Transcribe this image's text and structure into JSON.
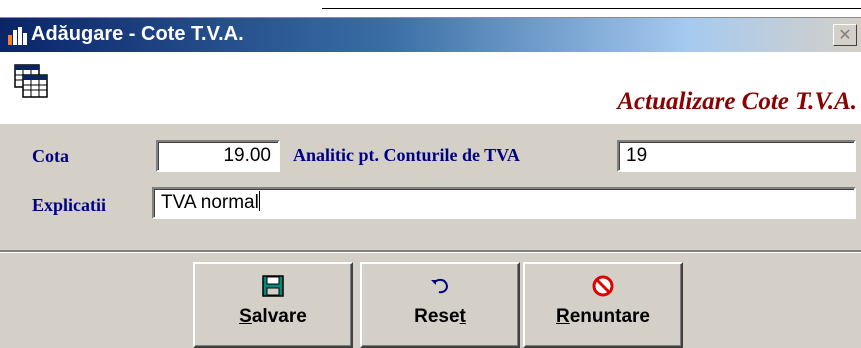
{
  "window": {
    "title": "Adăugare - Cote T.V.A.",
    "close_symbol": "✕"
  },
  "banner": {
    "title": "Actualizare Cote T.V.A."
  },
  "form": {
    "cota_label": "Cota",
    "cota_value": "19.00",
    "analitic_label": "Analitic pt. Conturile de TVA",
    "analitic_value": "19",
    "explicatii_label": "Explicatii",
    "explicatii_value": "TVA normal"
  },
  "buttons": {
    "save": {
      "accel": "S",
      "rest": "alvare",
      "icon": "floppy-disk-icon"
    },
    "reset": {
      "pre": "Rese",
      "accel": "t",
      "icon": "undo-arrow-icon"
    },
    "cancel": {
      "accel": "R",
      "rest": "enuntare",
      "icon": "prohibited-icon"
    }
  },
  "colors": {
    "title_gradient_start": "#0a246a",
    "label_color": "#000080",
    "banner_title_color": "#8b0000",
    "face": "#d4d0c8"
  }
}
